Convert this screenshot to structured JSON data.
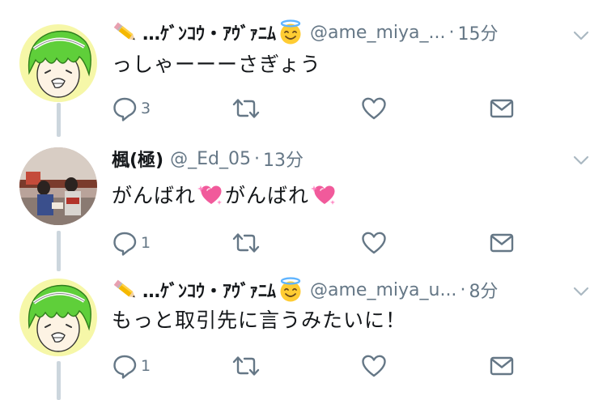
{
  "tweets": [
    {
      "author_name": "…ｹﾞﾝｺｳ・ｱｳﾞｧﾆﾑ",
      "handle": "@ame_miya_...",
      "separator": "·",
      "time": "15分",
      "text_parts": [
        "っしゃーーーさぎょう"
      ],
      "reply_count": "3",
      "retweet_count": "",
      "like_count": ""
    },
    {
      "author_name": "楓(極)",
      "handle": "@_Ed_05",
      "separator": "·",
      "time": "13分",
      "text_parts": [
        "がんばれ",
        "がんばれ"
      ],
      "reply_count": "1",
      "retweet_count": "",
      "like_count": ""
    },
    {
      "author_name": "…ｹﾞﾝｺｳ・ｱｳﾞｧﾆﾑ",
      "handle": "@ame_miya_u...",
      "separator": "·",
      "time": "8分",
      "text_parts": [
        "もっと取引先に言うみたいに！"
      ],
      "reply_count": "1",
      "retweet_count": "",
      "like_count": ""
    }
  ],
  "icons": {
    "author_prefix": "pencil-icon",
    "author_suffix": "halo-smile-icon",
    "inline_emoji": "sparkling-heart-icon",
    "reply": "reply-icon",
    "retweet": "retweet-icon",
    "like": "heart-icon",
    "dm": "envelope-icon",
    "menu": "chevron-down-icon"
  },
  "colors": {
    "text": "#14171a",
    "secondary": "#657786",
    "thread_line": "#ccd6dd",
    "icon": "#657786"
  }
}
